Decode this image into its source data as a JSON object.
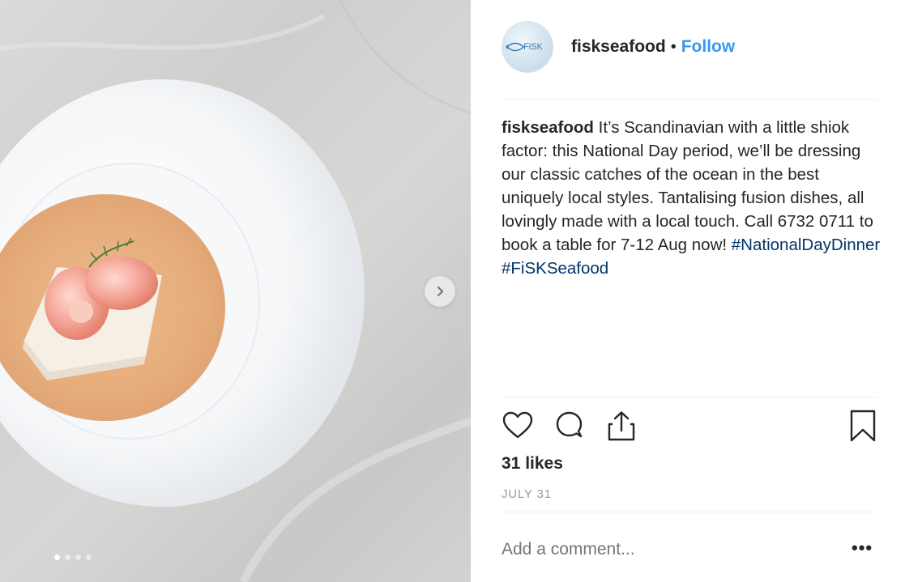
{
  "post": {
    "username": "fiskseafood",
    "separator": "•",
    "follow_label": "Follow",
    "avatar_logo_text": "FiSK",
    "caption": {
      "username": "fiskseafood",
      "text": " It’s Scandinavian with a little shiok factor: this National Day period, we’ll be dressing our classic catches of the ocean in the best uniquely local styles. Tantalising fusion dishes, all lovingly made with a local touch. Call 6732 0711 to book a table for 7-12 Aug now! ",
      "hashtags": [
        "#NationalDayDinner",
        "#FiSKSeafood"
      ]
    },
    "likes": "31 likes",
    "date": "JULY 31",
    "comment_placeholder": "Add a comment...",
    "more_label": "•••"
  },
  "carousel": {
    "slide_count": 4,
    "active_index": 0
  },
  "icons": {
    "like": "heart-icon",
    "comment": "comment-icon",
    "share": "share-icon",
    "save": "bookmark-icon",
    "next": "chevron-right-icon"
  },
  "colors": {
    "follow": "#3897f0",
    "hashtag": "#003569",
    "muted": "#999999",
    "text": "#262626"
  }
}
